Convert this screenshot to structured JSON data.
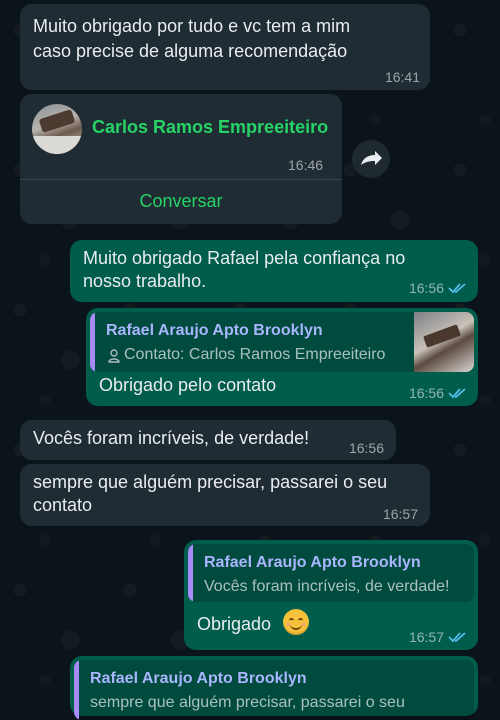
{
  "messages": {
    "m1": {
      "text_line1": "Muito obrigado por tudo e vc tem a mim",
      "text_line2": "caso precise de alguma recomendação",
      "time": "16:41"
    },
    "contact_card": {
      "name": "Carlos Ramos Empreeiteiro",
      "time": "16:46",
      "action": "Conversar"
    },
    "m2": {
      "text_line1": "Muito obrigado Rafael pela confiança no",
      "text_line2": "nosso trabalho.",
      "time": "16:56"
    },
    "m3": {
      "quote_author": "Rafael Araujo Apto Brooklyn",
      "quote_text": "Contato: Carlos Ramos Empreeiteiro",
      "text": "Obrigado pelo contato",
      "time": "16:56"
    },
    "m4": {
      "text": "Vocês foram incríveis, de verdade!",
      "time": "16:56"
    },
    "m5": {
      "text_line1": "sempre que alguém precisar, passarei o seu",
      "text_line2": "contato",
      "time": "16:57"
    },
    "m6": {
      "quote_author": "Rafael Araujo Apto Brooklyn",
      "quote_text": "Vocês foram incríveis, de verdade!",
      "text": "Obrigado",
      "emoji": "☺️",
      "time": "16:57"
    },
    "m7": {
      "quote_author": "Rafael Araujo Apto Brooklyn",
      "quote_text": "sempre que alguém precisar, passarei o seu"
    }
  },
  "colors": {
    "background": "#0b141a",
    "incoming_bubble": "#202c33",
    "outgoing_bubble": "#005c4b",
    "accent_green": "#25d366",
    "read_ticks": "#53bdeb",
    "quote_name": "#a9b6ff"
  },
  "icons": {
    "forward": "forward-icon",
    "person": "person-icon",
    "read_receipt": "double-check-icon"
  }
}
